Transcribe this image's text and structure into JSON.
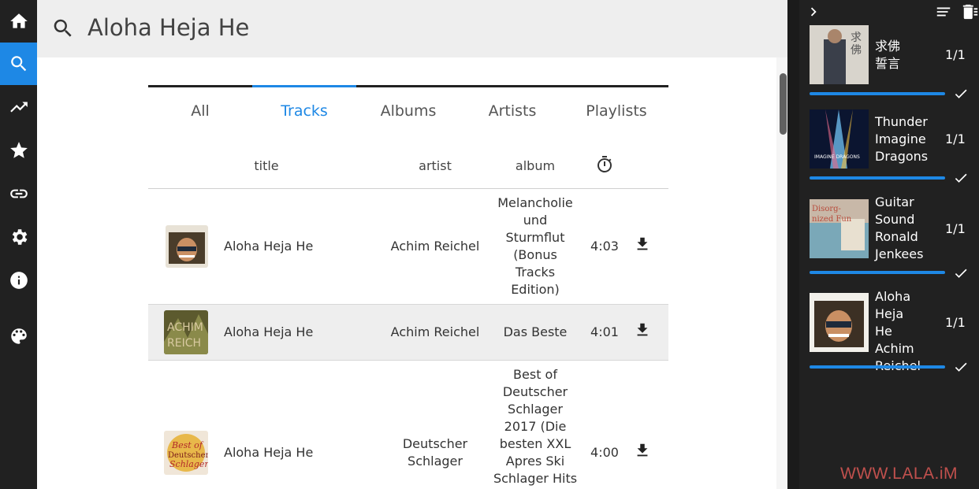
{
  "nav": {
    "items": [
      {
        "name": "home",
        "icon": "home-icon"
      },
      {
        "name": "search",
        "icon": "search-icon",
        "active": true
      },
      {
        "name": "trending",
        "icon": "trending-up-icon"
      },
      {
        "name": "favorites",
        "icon": "star-icon"
      },
      {
        "name": "link",
        "icon": "link-icon"
      },
      {
        "name": "settings",
        "icon": "gear-icon"
      },
      {
        "name": "info",
        "icon": "info-icon"
      },
      {
        "name": "theme",
        "icon": "palette-icon"
      }
    ]
  },
  "search": {
    "query": "Aloha Heja He"
  },
  "tabs": [
    {
      "label": "All"
    },
    {
      "label": "Tracks",
      "active": true
    },
    {
      "label": "Albums"
    },
    {
      "label": "Artists"
    },
    {
      "label": "Playlists"
    }
  ],
  "table": {
    "headers": {
      "title": "title",
      "artist": "artist",
      "album": "album",
      "duration_icon": "stopwatch-icon"
    },
    "rows": [
      {
        "title": "Aloha Heja He",
        "artist": "Achim Reichel",
        "album_lines": [
          "Melancholie",
          "und",
          "Sturmflut",
          "(Bonus",
          "Tracks",
          "Edition)"
        ],
        "duration": "4:03",
        "selected": false
      },
      {
        "title": "Aloha Heja He",
        "artist": "Achim Reichel",
        "album_lines": [
          "Das Beste"
        ],
        "duration": "4:01",
        "selected": true
      },
      {
        "title": "Aloha Heja He",
        "artist_lines": [
          "Deutscher",
          "Schlager"
        ],
        "album_lines": [
          "Best of",
          "Deutscher",
          "Schlager",
          "2017 (Die",
          "besten XXL",
          "Apres Ski",
          "Schlager Hits"
        ],
        "duration": "4:00",
        "selected": false
      }
    ]
  },
  "queue": {
    "items": [
      {
        "lines": [
          "求佛",
          "誓言"
        ],
        "count": "1/1",
        "progress": 1.0
      },
      {
        "lines": [
          "Thunder",
          "Imagine",
          "Dragons"
        ],
        "count": "1/1",
        "progress": 1.0
      },
      {
        "lines": [
          "Guitar",
          "Sound",
          "Ronald",
          "Jenkees"
        ],
        "count": "1/1",
        "progress": 1.0
      },
      {
        "lines": [
          "Aloha Heja",
          "He",
          "Achim",
          "Reichel"
        ],
        "count": "1/1",
        "progress": 1.0
      }
    ]
  },
  "watermark": "WWW.LALA.iM",
  "colors": {
    "accent": "#1e88e5",
    "nav_bg": "#212121",
    "queue_bg": "#212121",
    "header_bg": "#eeeeee",
    "watermark": "#c0504d"
  }
}
